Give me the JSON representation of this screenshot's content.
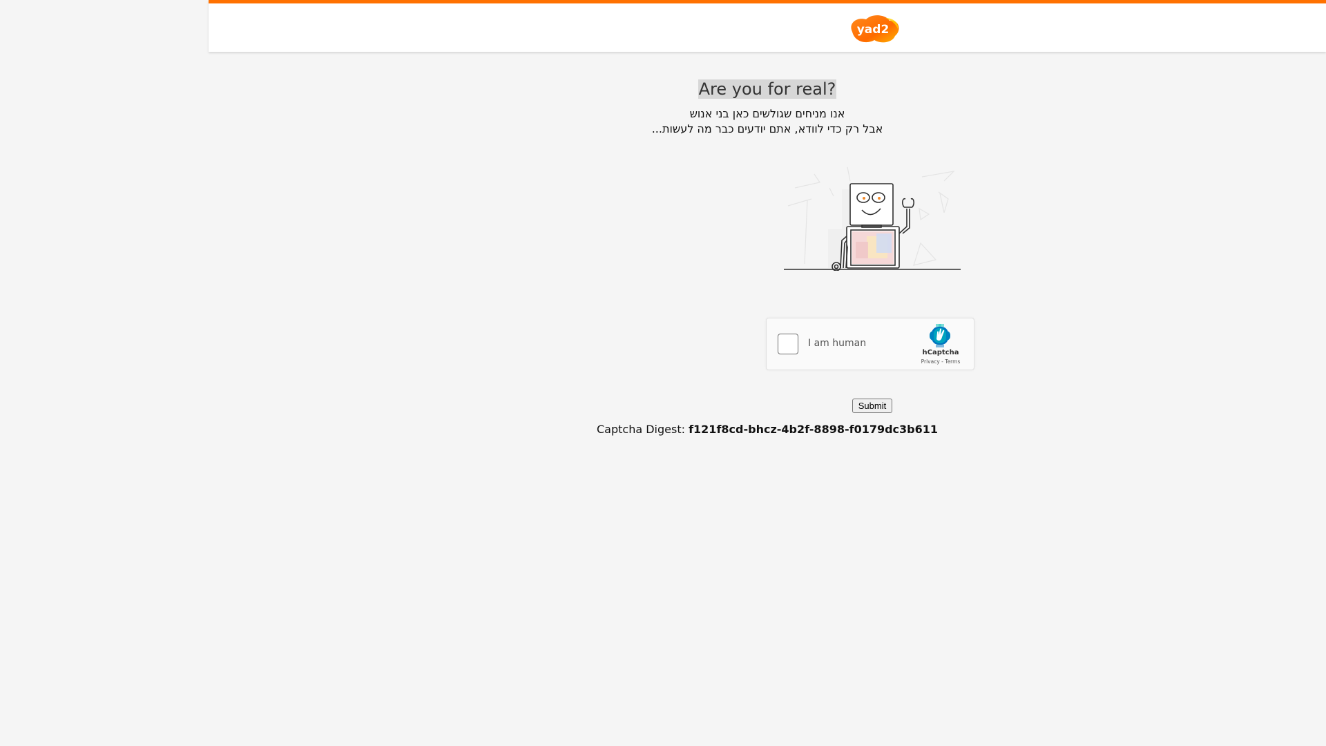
{
  "header": {
    "logo_text": "yad2",
    "accent_color": "#ff7100"
  },
  "main": {
    "title": "Are you for real?",
    "subtitle_lines": [
      "אנו מניחים שגולשים כאן בני אנוש",
      "אבל רק כדי לוודא, אתם יודעים כבר מה לעשות..."
    ],
    "robot_icon": "robot-waving-illustration"
  },
  "captcha": {
    "checkbox_label": "I am human",
    "brand": "hCaptcha",
    "privacy_link": "Privacy",
    "separator": " - ",
    "terms_link": "Terms",
    "brand_color": "#0074bf",
    "brand_color_secondary": "#00bfb5"
  },
  "form": {
    "submit_label": "Submit"
  },
  "digest": {
    "label": "Captcha Digest:",
    "value": "f121f8cd-bhcz-4b2f-8898-f0179dc3b611"
  }
}
